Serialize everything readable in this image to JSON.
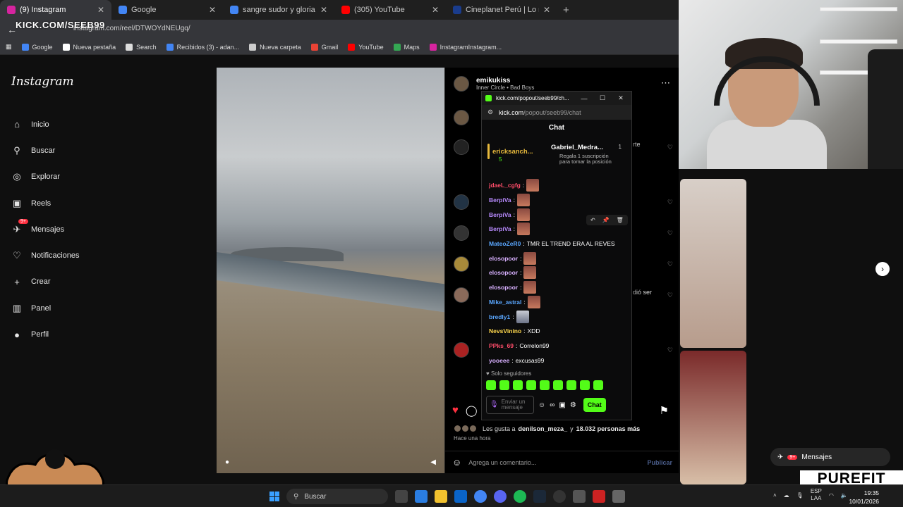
{
  "browser": {
    "tabs": [
      {
        "title": "(9) Instagram",
        "color": "#d6249f",
        "active": true
      },
      {
        "title": "Google",
        "color": "#4285f4"
      },
      {
        "title": "sangre sudor y gloria - Buscar c",
        "color": "#4285f4"
      },
      {
        "title": "(305) YouTube",
        "color": "#ff0000"
      },
      {
        "title": "Cineplanet Perú | Lo mejor del c",
        "color": "#1a3c8c"
      }
    ],
    "overlay_text": "KICK.COM/SEEB99",
    "url": "instagram.com/reel/DTWOYdNEUgq/",
    "bookmarks": [
      {
        "label": "Google",
        "color": "#4285f4"
      },
      {
        "label": "Nueva pestaña",
        "color": "#fff"
      },
      {
        "label": "Search",
        "color": "#ddd"
      },
      {
        "label": "Recibidos (3) - adan...",
        "color": "#4285f4"
      },
      {
        "label": "Nueva carpeta",
        "color": "#ccc"
      },
      {
        "label": "Gmail",
        "color": "#ea4335"
      },
      {
        "label": "YouTube",
        "color": "#ff0000"
      },
      {
        "label": "Maps",
        "color": "#34a853"
      },
      {
        "label": "InstagramInstagram...",
        "color": "#d6249f"
      }
    ]
  },
  "instagram": {
    "logo": "Instagram",
    "nav": [
      {
        "label": "Inicio",
        "icon": "home-icon",
        "glyph": "⌂"
      },
      {
        "label": "Buscar",
        "icon": "search-icon",
        "glyph": "⚲"
      },
      {
        "label": "Explorar",
        "icon": "compass-icon",
        "glyph": "◎"
      },
      {
        "label": "Reels",
        "icon": "reels-icon",
        "glyph": "▣"
      },
      {
        "label": "Mensajes",
        "icon": "messenger-icon",
        "glyph": "✈",
        "badge": "9+"
      },
      {
        "label": "Notificaciones",
        "icon": "heart-icon",
        "glyph": "♡"
      },
      {
        "label": "Crear",
        "icon": "plus-icon",
        "glyph": "+"
      },
      {
        "label": "Panel",
        "icon": "dashboard-icon",
        "glyph": "▥"
      },
      {
        "label": "Perfil",
        "icon": "profile-icon",
        "glyph": "●"
      }
    ],
    "post": {
      "author": "emikukiss",
      "subtitle": "Inner Circle • Bad Boys",
      "comment_frags": {
        "a": "rte",
        "b": "dió ser"
      },
      "likes_user": "denilson_meza_",
      "likes_mid": "Les gusta a",
      "likes_and": "y",
      "likes_count": "18.032 personas más",
      "time_ago": "Hace una hora",
      "comment_placeholder": "Agrega un comentario...",
      "publish": "Publicar"
    },
    "messages_pill": {
      "label": "Mensajes",
      "badge": "9+"
    }
  },
  "kick": {
    "window_title": "kick.com/popout/seeb99/ch...",
    "url_host": "kick.com",
    "url_path": "/popout/seeb99/chat",
    "header": "Chat",
    "pinned_left": {
      "name": "ericksanch...",
      "count": "5"
    },
    "pinned_right": {
      "name": "Gabriel_Medra...",
      "num": "1",
      "text1": "Regala 1 suscripción",
      "text2": "para tomar la posición"
    },
    "messages": [
      {
        "user": "jdaeL_cgfg",
        "color": "#ff4d6a",
        "text": "",
        "emote": true
      },
      {
        "user": "BerpiVa",
        "color": "#b98bff",
        "text": "",
        "emote": true
      },
      {
        "user": "BerpiVa",
        "color": "#b98bff",
        "text": "",
        "emote": true
      },
      {
        "user": "BerpiVa",
        "color": "#b98bff",
        "text": "",
        "emote": true
      },
      {
        "user": "MateoZeR0",
        "color": "#5aa7ff",
        "text": "TMR EL TREND ERA AL REVES",
        "emote": false
      },
      {
        "user": "elosopoor",
        "color": "#d8b0ff",
        "text": "",
        "emote": true
      },
      {
        "user": "elosopoor",
        "color": "#d8b0ff",
        "text": "",
        "emote": true
      },
      {
        "user": "elosopoor",
        "color": "#d8b0ff",
        "text": "",
        "emote": true
      },
      {
        "user": "Mike_astral",
        "color": "#5aa7ff",
        "text": "",
        "emote": true
      },
      {
        "user": "bredly1",
        "color": "#5aa7ff",
        "text": "",
        "emote": true,
        "alt": true
      },
      {
        "user": "NevsVinino",
        "color": "#ffd84d",
        "text": "XDD",
        "emote": false
      },
      {
        "user": "PPks_69",
        "color": "#ff4d6a",
        "text": "Correlon99",
        "emote": false
      },
      {
        "user": "yooeee",
        "color": "#d8b0ff",
        "text": "excusas99",
        "emote": false
      }
    ],
    "followers_only": "Solo seguidores",
    "input_placeholder": "Enviar un mensaje",
    "send_label": "Chat"
  },
  "taskbar": {
    "search": "Buscar",
    "lang1": "ESP",
    "lang2": "LAA",
    "time": "19:35",
    "date": "10/01/2026"
  },
  "watermark": "PUREFIT"
}
